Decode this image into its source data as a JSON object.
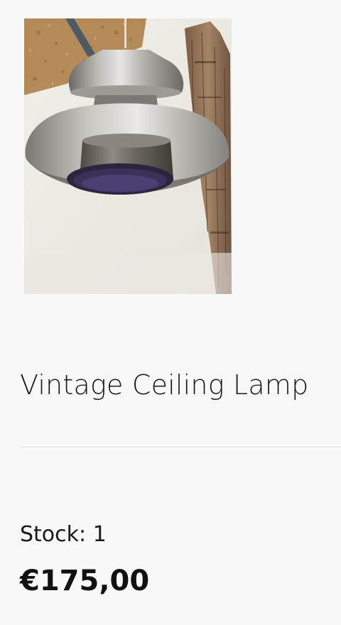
{
  "product": {
    "image_alt": "Vintage ceiling lamp photo",
    "title": "Vintage Ceiling Lamp",
    "stock": {
      "label": "Stock:",
      "value": "1"
    },
    "price": "€175,00"
  }
}
